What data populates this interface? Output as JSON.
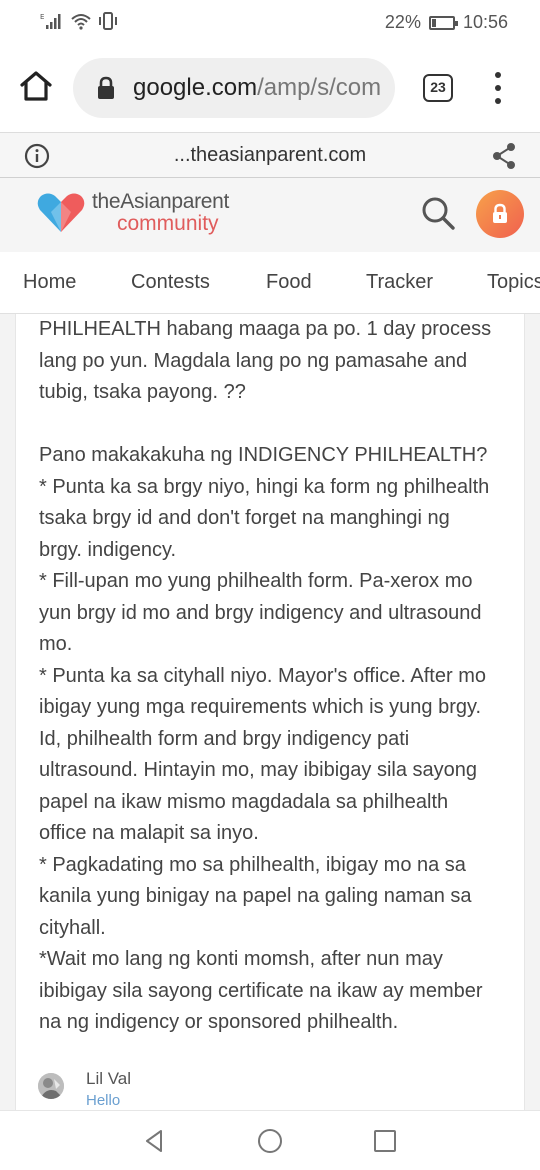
{
  "status_bar": {
    "signal_label": "E",
    "battery_percent_text": "22%",
    "battery_level": 0.22,
    "time": "10:56"
  },
  "browser": {
    "url_main": "google.com",
    "url_path": "/amp/s/com",
    "tab_count": "23"
  },
  "amp_bar": {
    "domain": "...theasianparent.com"
  },
  "site": {
    "logo_top": "theAsianparent",
    "logo_bottom": "community",
    "accent_color": "#e05c5c"
  },
  "nav": {
    "items": [
      {
        "label": "Home"
      },
      {
        "label": "Contests"
      },
      {
        "label": "Food"
      },
      {
        "label": "Tracker"
      },
      {
        "label": "Topics"
      }
    ]
  },
  "post": {
    "lines": [
      "PHILHEALTH habang maaga pa po. 1 day process",
      "lang po yun. Magdala lang po ng pamasahe and",
      "tubig, tsaka payong. ??",
      "",
      "Pano makakakuha ng INDIGENCY PHILHEALTH?",
      "* Punta ka sa brgy niyo, hingi ka form ng philhealth",
      "tsaka brgy id and don't forget na manghingi ng",
      "brgy. indigency.",
      "* Fill-upan mo yung philhealth form. Pa-xerox mo",
      "yun brgy id mo and brgy indigency and ultrasound",
      "mo.",
      "* Punta ka sa cityhall niyo. Mayor's office. After mo",
      "ibigay yung mga requirements which is yung brgy.",
      "Id, philhealth form and brgy indigency pati",
      "ultrasound. Hintayin mo, may ibibigay sila sayong",
      "papel na ikaw mismo magdadala sa philhealth",
      "office na malapit sa inyo.",
      "* Pagkadating mo sa philhealth, ibigay mo na sa",
      "kanila yung binigay na papel na galing naman sa",
      "cityhall.",
      "*Wait mo lang ng konti momsh, after nun may",
      "ibibigay sila sayong certificate na ikaw ay member",
      "na ng indigency or sponsored philhealth."
    ]
  },
  "author": {
    "name": "Lil Val",
    "subtitle": "Hello"
  }
}
